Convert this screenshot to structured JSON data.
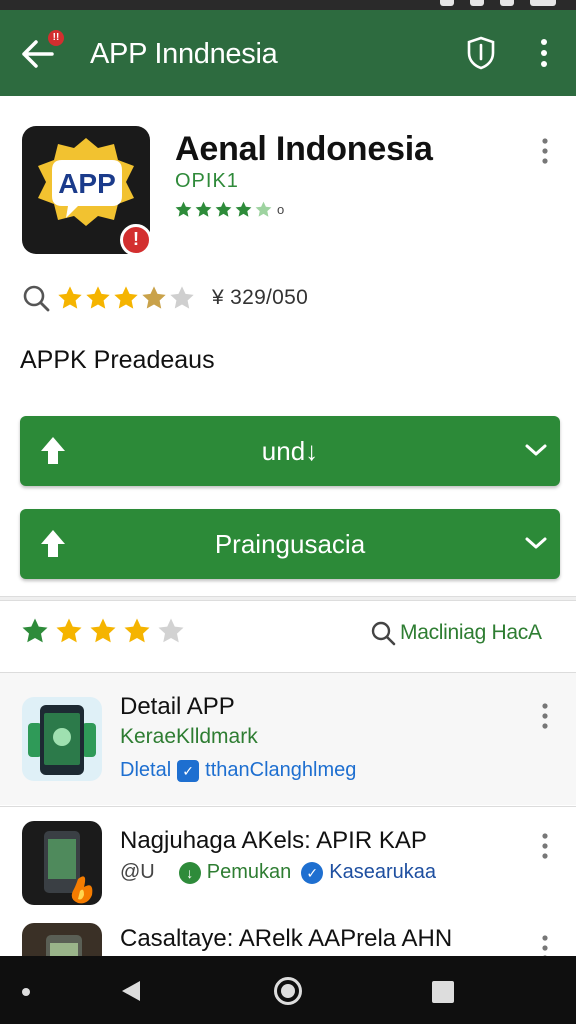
{
  "app_bar": {
    "title": "APP Inndnesia",
    "notif_badge": "!!",
    "back_icon": "arrow-left-icon",
    "shield_icon": "shield-icon",
    "menu_icon": "more-vert-icon"
  },
  "app_header": {
    "icon_text": "APP",
    "icon_badge": "!",
    "name": "Aenal Indonesia",
    "developer": "OPIK1",
    "rating_suffix": "o",
    "rating_stars": 4.5
  },
  "rating_row": {
    "stars": 3.5,
    "count": "¥ 329/050"
  },
  "section_title": "APPK Preadeaus",
  "buttons": [
    {
      "label": "und↓"
    },
    {
      "label": "Praingusacia"
    }
  ],
  "rate_bar": {
    "stars": 4,
    "search_label": "Macliniag HacA"
  },
  "list": [
    {
      "title": "Detail APP",
      "subtitle": "KeraeKlldmark",
      "meta_left": "Dletal",
      "meta_right": "tthanClanghlmeg"
    },
    {
      "title": "Nagjuhaga AKels: APIR KAP",
      "meta_left": "@U",
      "meta_mid": "Pemukan",
      "meta_right": "Kasearukaa"
    },
    {
      "title": "Casaltaye: ARelk AAPrela AHN"
    }
  ],
  "colors": {
    "app_bar": "#2d6b3f",
    "button_green": "#2c8a38",
    "text_green": "#2e7d32",
    "star_gold": "#f5b400",
    "star_green": "#2e8b3a",
    "badge_red": "#d32f2f"
  }
}
